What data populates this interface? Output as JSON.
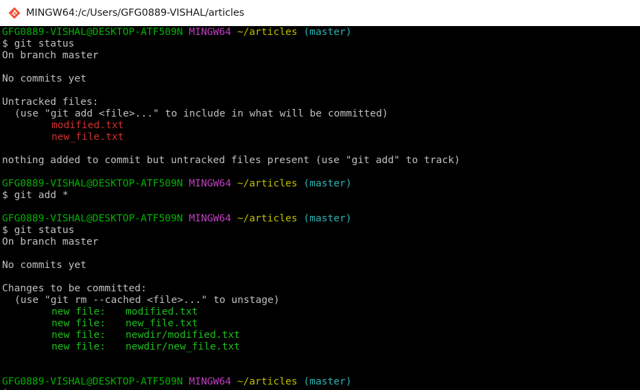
{
  "window": {
    "title": "MINGW64:/c/Users/GFG0889-VISHAL/articles",
    "icon": "git-bash-diamond-icon"
  },
  "prompt": {
    "user_host": "GFG0889-VISHAL@DESKTOP-ATF509N",
    "system": "MINGW64",
    "path": "~/articles",
    "branch": "(master)"
  },
  "session": {
    "cmd1": "$ git status",
    "on_branch_1": "On branch master",
    "no_commits_1": "No commits yet",
    "untracked_header": "Untracked files:",
    "untracked_hint": "(use \"git add <file>...\" to include in what will be committed)",
    "untracked_files": [
      "modified.txt",
      "new_file.txt"
    ],
    "nothing_added": "nothing added to commit but untracked files present (use \"git add\" to track)",
    "cmd2": "$ git add *",
    "cmd3": "$ git status",
    "on_branch_2": "On branch master",
    "no_commits_2": "No commits yet",
    "changes_header": "Changes to be committed:",
    "changes_hint": "(use \"git rm --cached <file>...\" to unstage)",
    "staged_label": "new file:",
    "staged_files": [
      "modified.txt",
      "new_file.txt",
      "newdir/modified.txt",
      "newdir/new_file.txt"
    ],
    "cmd4_partial": "$ "
  },
  "colors": {
    "user_host": "#00b300",
    "system": "#c13ec1",
    "path": "#bfbf00",
    "branch": "#2fb3b3",
    "untracked": "#d03030",
    "staged": "#1fbf1f",
    "text": "#c0c0c0"
  }
}
